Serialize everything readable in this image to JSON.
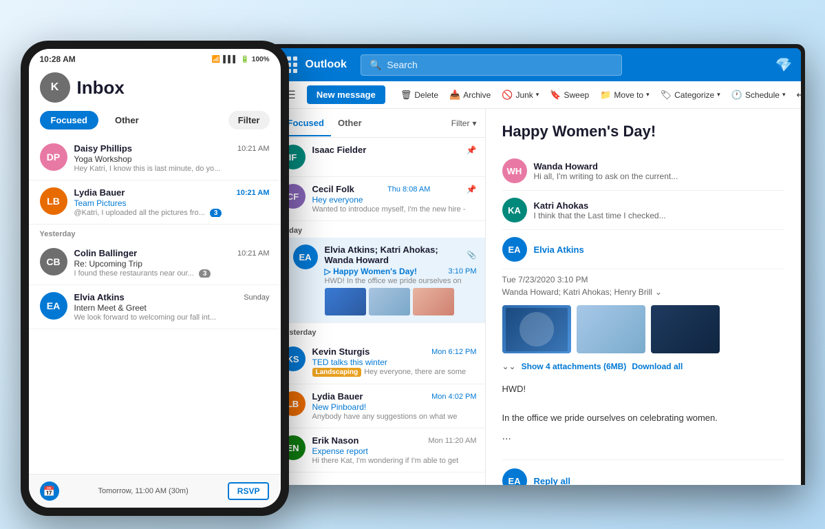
{
  "phone": {
    "status": {
      "time": "10:28 AM",
      "wifi": "WiFi",
      "signal": "Signal",
      "battery": "100%"
    },
    "inbox": {
      "title": "Inbox",
      "tab_focused": "Focused",
      "tab_other": "Other",
      "filter_label": "Filter"
    },
    "messages": [
      {
        "sender": "Daisy Phillips",
        "time": "10:21 AM",
        "time_blue": false,
        "subject": "Yoga Workshop",
        "preview": "Hey Katri, I know this is last minute, do yo...",
        "avatar_initials": "DP",
        "avatar_color": "bg-pink"
      },
      {
        "sender": "Lydia Bauer",
        "time": "10:21 AM",
        "time_blue": true,
        "subject": "Team Pictures",
        "preview": "@Katri, I uploaded all the pictures fro...",
        "badge": "3",
        "avatar_initials": "LB",
        "avatar_color": "bg-orange",
        "at_icon": true
      }
    ],
    "yesterday_label": "Yesterday",
    "yesterday_messages": [
      {
        "sender": "Colin Ballinger",
        "time": "10:21 AM",
        "time_blue": false,
        "subject": "Re: Upcoming Trip",
        "preview": "I found these restaurants near our...",
        "badge": "3",
        "avatar_initials": "CB",
        "avatar_color": "bg-gray"
      },
      {
        "sender": "Elvia Atkins",
        "time": "Sunday",
        "time_blue": false,
        "subject": "Intern Meet & Greet",
        "preview": "We look forward to welcoming our fall int...",
        "avatar_initials": "EA",
        "avatar_color": "bg-blue"
      }
    ],
    "footer": {
      "text": "Tomorrow, 11:00 AM (30m)",
      "rsvp_label": "RSVP"
    }
  },
  "desktop": {
    "topbar": {
      "app_name": "Outlook",
      "search_placeholder": "Search"
    },
    "toolbar": {
      "new_message_label": "New message",
      "delete_label": "Delete",
      "archive_label": "Archive",
      "junk_label": "Junk",
      "sweep_label": "Sweep",
      "move_to_label": "Move to",
      "categorize_label": "Categorize",
      "schedule_label": "Schedule",
      "undo_label": "Undo",
      "more_label": "..."
    },
    "mail_list": {
      "tab_focused": "Focused",
      "tab_other": "Other",
      "filter_label": "Filter",
      "pinned_messages": [
        {
          "sender": "Isaac Fielder",
          "time": "",
          "time_blue": false,
          "subject": "",
          "preview": "",
          "avatar_initials": "IF",
          "avatar_color": "bg-teal",
          "pinned": true
        },
        {
          "sender": "Cecil Folk",
          "time": "Thu 8:08 AM",
          "time_blue": true,
          "subject": "Hey everyone",
          "preview": "Wanted to introduce myself, I'm the new hire -",
          "avatar_initials": "CF",
          "avatar_color": "bg-purple",
          "pinned": true
        }
      ],
      "today_label": "Today",
      "today_messages": [
        {
          "sender": "Elvia Atkins; Katri Ahokas; Wanda Howard",
          "time": "3:10 PM",
          "time_blue": true,
          "subject": "Happy Women's Day!",
          "preview": "HWD! In the office we pride ourselves on",
          "avatar_initials": "EA",
          "avatar_color": "bg-blue",
          "selected": true,
          "has_attachment": true,
          "has_thumbs": true
        }
      ],
      "yesterday_label": "Yesterday",
      "yesterday_messages": [
        {
          "sender": "Kevin Sturgis",
          "time": "Mon 6:12 PM",
          "time_blue": true,
          "subject": "TED talks this winter",
          "preview": "Hey everyone, there are some",
          "avatar_initials": "KS",
          "avatar_color": "bg-blue",
          "tag": "Landscaping"
        },
        {
          "sender": "Lydia Bauer",
          "time": "Mon 4:02 PM",
          "time_blue": true,
          "subject": "New Pinboard!",
          "preview": "Anybody have any suggestions on what we",
          "avatar_initials": "LB",
          "avatar_color": "bg-orange"
        },
        {
          "sender": "Erik Nason",
          "time": "Mon 11:20 AM",
          "time_blue": false,
          "subject": "Expense report",
          "preview": "Hi there Kat, I'm wondering if I'm able to get",
          "avatar_initials": "EN",
          "avatar_color": "bg-green"
        }
      ]
    },
    "reading_pane": {
      "email_title": "Happy Women's Day!",
      "contacts": [
        {
          "name": "Wanda Howard",
          "preview": "Hi all, I'm writing to ask on the current...",
          "avatar_initials": "WH",
          "avatar_color": "bg-pink",
          "name_blue": false
        },
        {
          "name": "Katri Ahokas",
          "preview": "I think that the Last time I checked...",
          "avatar_initials": "KA",
          "avatar_color": "bg-teal",
          "name_blue": false
        },
        {
          "name": "Elvia Atkins",
          "preview": "",
          "avatar_initials": "EA",
          "avatar_color": "bg-blue",
          "name_blue": true
        }
      ],
      "email_meta_date": "Tue 7/23/2020 3:10 PM",
      "email_meta_to": "Wanda Howard; Katri Ahokas; Henry Brill",
      "attachments_label": "Show 4 attachments (6MB)",
      "download_all_label": "Download all",
      "body_line1": "HWD!",
      "body_line2": "In the office we pride ourselves on celebrating women.",
      "ellipsis": "...",
      "reply_all_label": "Reply all"
    }
  }
}
